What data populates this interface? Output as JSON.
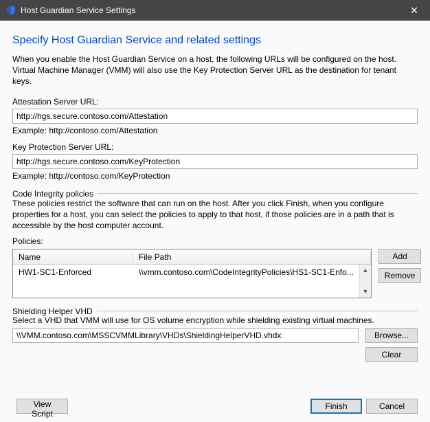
{
  "window": {
    "title": "Host Guardian Service Settings",
    "close_glyph": "✕"
  },
  "page": {
    "heading": "Specify Host Guardian Service and related settings",
    "intro": "When you enable the Host Guardian Service on a host, the following URLs will be configured on the host. Virtual Machine Manager (VMM) will also use the Key Protection Server URL as the destination for tenant keys."
  },
  "attestation": {
    "label": "Attestation Server URL:",
    "value": "http://hgs.secure.contoso.com/Attestation",
    "example": "Example: http://contoso.com/Attestation"
  },
  "keyprotection": {
    "label": "Key Protection Server URL:",
    "value": "http://hgs.secure.contoso.com/KeyProtection",
    "example": "Example: http://contoso.com/KeyProtection"
  },
  "code_integrity": {
    "legend": "Code Integrity policies",
    "description": "These policies restrict the software that can run on the host. After you click Finish, when you configure properties for a host, you can select the policies to apply to that host, if those policies are in a path that is accessible by the host computer account.",
    "policies_label": "Policies:",
    "columns": {
      "name": "Name",
      "path": "File Path"
    },
    "rows": [
      {
        "name": "HW1-SC1-Enforced",
        "path": "\\\\vmm.contoso.com\\CodeIntegrityPolicies\\HS1-SC1-Enfo..."
      }
    ],
    "buttons": {
      "add": "Add",
      "remove": "Remove"
    }
  },
  "shielding_vhd": {
    "legend": "Shielding Helper VHD",
    "description": "Select a VHD that VMM will use for OS volume encryption while shielding existing virtual machines.",
    "value": "\\\\VMM.contoso.com\\MSSCVMMLibrary\\VHDs\\ShieldingHelperVHD.vhdx",
    "buttons": {
      "browse": "Browse...",
      "clear": "Clear"
    }
  },
  "footer": {
    "view_script": "View Script",
    "finish": "Finish",
    "cancel": "Cancel"
  }
}
